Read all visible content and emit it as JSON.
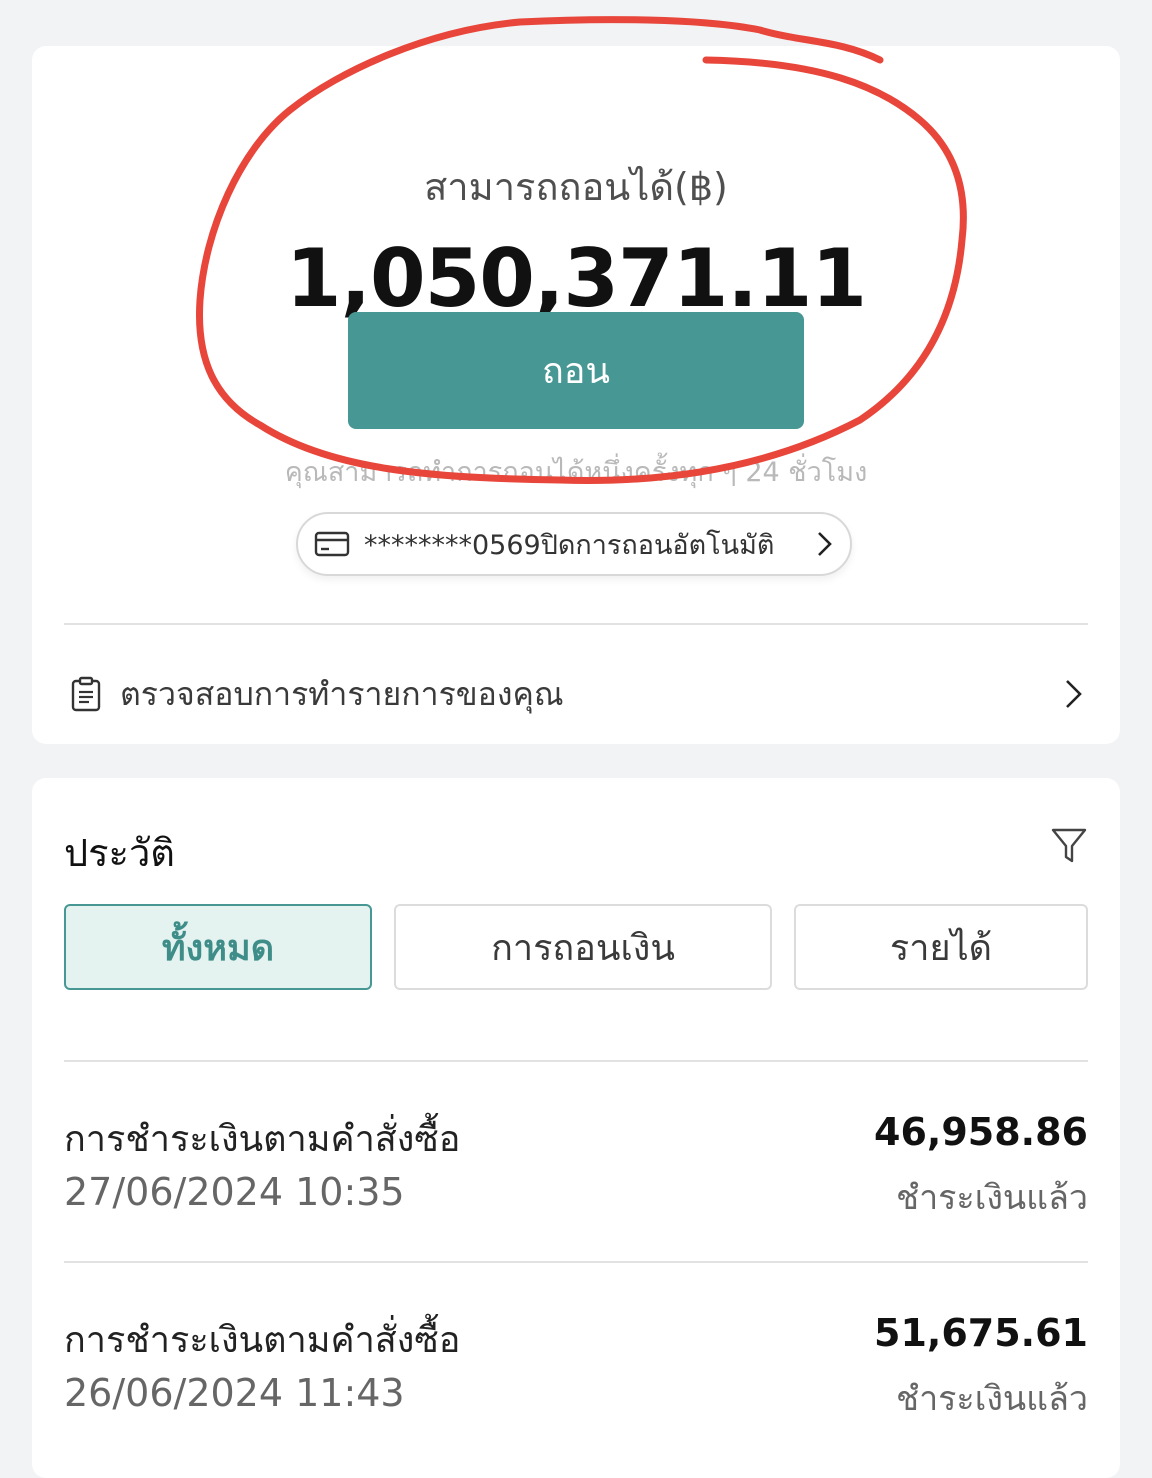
{
  "balance": {
    "label": "สามารถถอนได้(฿)",
    "amount": "1,050,371.11",
    "withdraw_button": "ถอน",
    "note": "คุณสามารถทำการถอนได้หนึ่งครั้งทุก ๆ 24 ชั่วโมง"
  },
  "bank_account": {
    "text": "********0569ปิดการถอนอัตโนมัติ",
    "icon": "credit-card-icon"
  },
  "check_transactions": {
    "label": "ตรวจสอบการทำรายการของคุณ",
    "icon": "clipboard-icon"
  },
  "history": {
    "title": "ประวัติ",
    "tabs": [
      {
        "label": "ทั้งหมด",
        "active": true
      },
      {
        "label": "การถอนเงิน",
        "active": false
      },
      {
        "label": "รายได้",
        "active": false
      }
    ],
    "transactions": [
      {
        "title": "การชำระเงินตามคำสั่งซื้อ",
        "date": "27/06/2024 10:35",
        "amount": "46,958.86",
        "status": "ชำระเงินแล้ว"
      },
      {
        "title": "การชำระเงินตามคำสั่งซื้อ",
        "date": "26/06/2024 11:43",
        "amount": "51,675.61",
        "status": "ชำระเงินแล้ว"
      }
    ]
  },
  "colors": {
    "accent": "#479894",
    "active_tab_bg": "#e4f2f0",
    "annotation": "#e8463a"
  }
}
